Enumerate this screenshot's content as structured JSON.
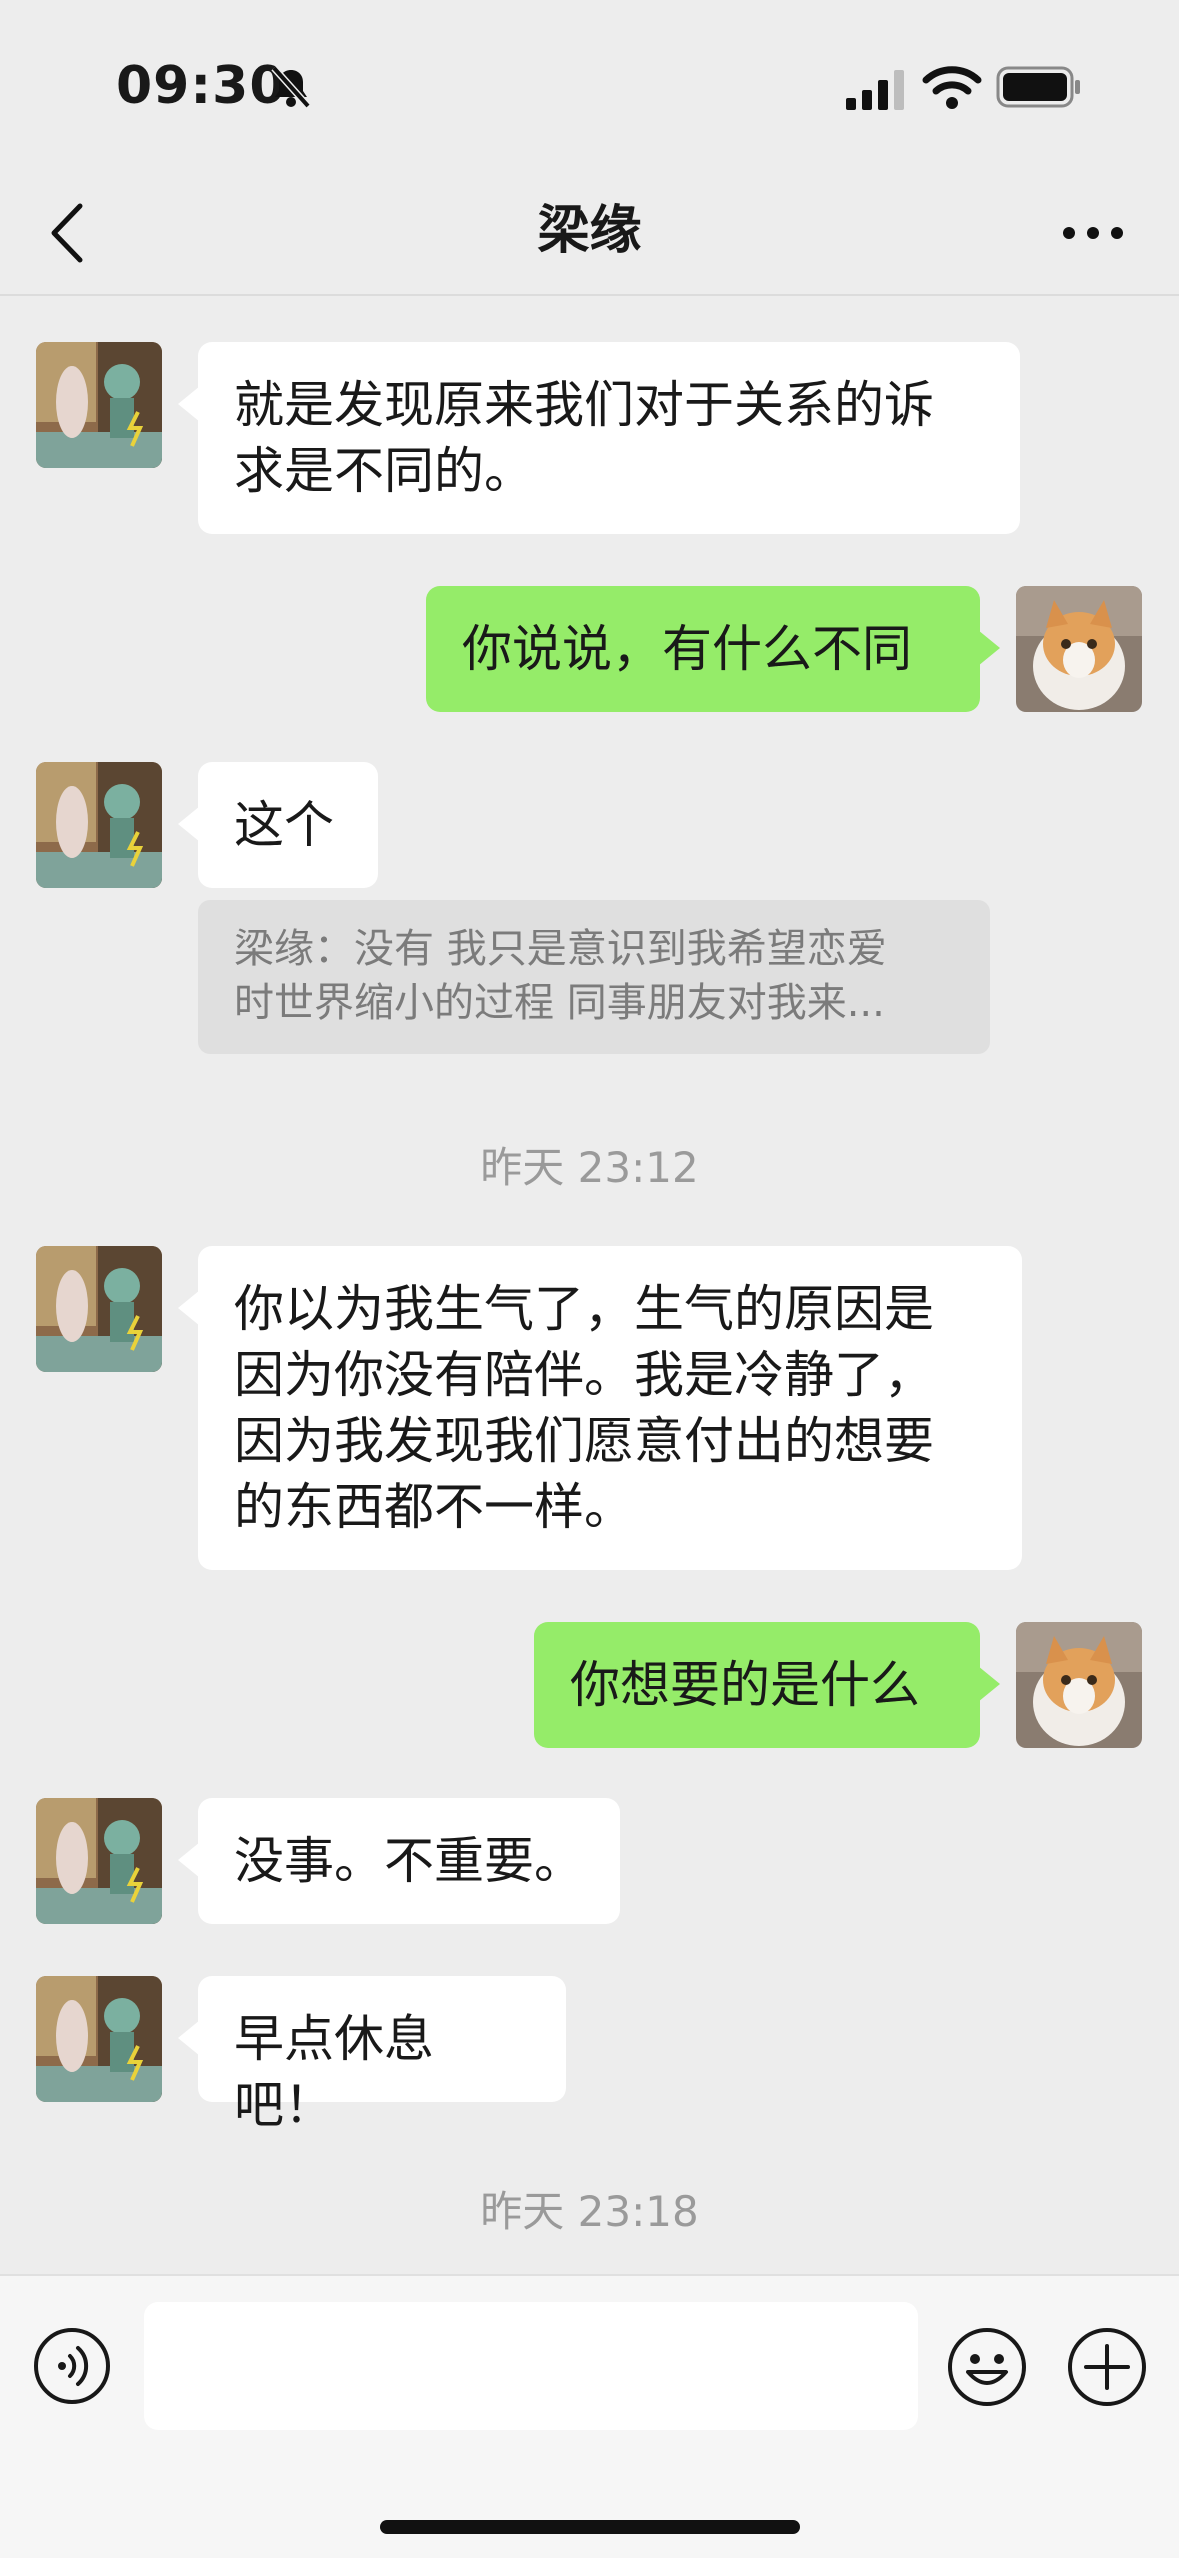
{
  "status_bar": {
    "time": "09:30",
    "icons": [
      "bell-slash-icon",
      "cellular-signal-icon",
      "wifi-icon",
      "battery-icon"
    ]
  },
  "nav": {
    "title": "梁缘",
    "back_icon": "chevron-left-icon",
    "more_icon": "more-dots-icon"
  },
  "messages": [
    {
      "side": "left",
      "text_lines": [
        "就是发现原来我们对于关系的诉",
        "求是不同的。"
      ]
    },
    {
      "side": "right",
      "text_lines": [
        "你说说，有什么不同"
      ]
    },
    {
      "side": "left",
      "text_lines": [
        "这个"
      ]
    },
    {
      "type": "quote",
      "text_lines": [
        "梁缘：没有 我只是意识到我希望恋爱",
        "时世界缩小的过程 同事朋友对我来..."
      ]
    },
    {
      "type": "timestamp",
      "text": "昨天 23:12"
    },
    {
      "side": "left",
      "text_lines": [
        "你以为我生气了，生气的原因是",
        "因为你没有陪伴。我是冷静了，",
        "因为我发现我们愿意付出的想要",
        "的东西都不一样。"
      ]
    },
    {
      "side": "right",
      "text_lines": [
        "你想要的是什么"
      ]
    },
    {
      "side": "left",
      "text_lines": [
        "没事。不重要。"
      ]
    },
    {
      "side": "left",
      "text_lines": [
        "早点休息吧！"
      ]
    },
    {
      "type": "timestamp",
      "text": "昨天 23:18"
    }
  ],
  "input_bar": {
    "voice_icon": "voice-icon",
    "emoji_icon": "emoji-icon",
    "plus_icon": "plus-icon",
    "input_value": ""
  },
  "colors": {
    "background": "#ededed",
    "outgoing_bubble": "#95ec69",
    "incoming_bubble": "#ffffff",
    "quote_bg": "#dfdfdf"
  }
}
